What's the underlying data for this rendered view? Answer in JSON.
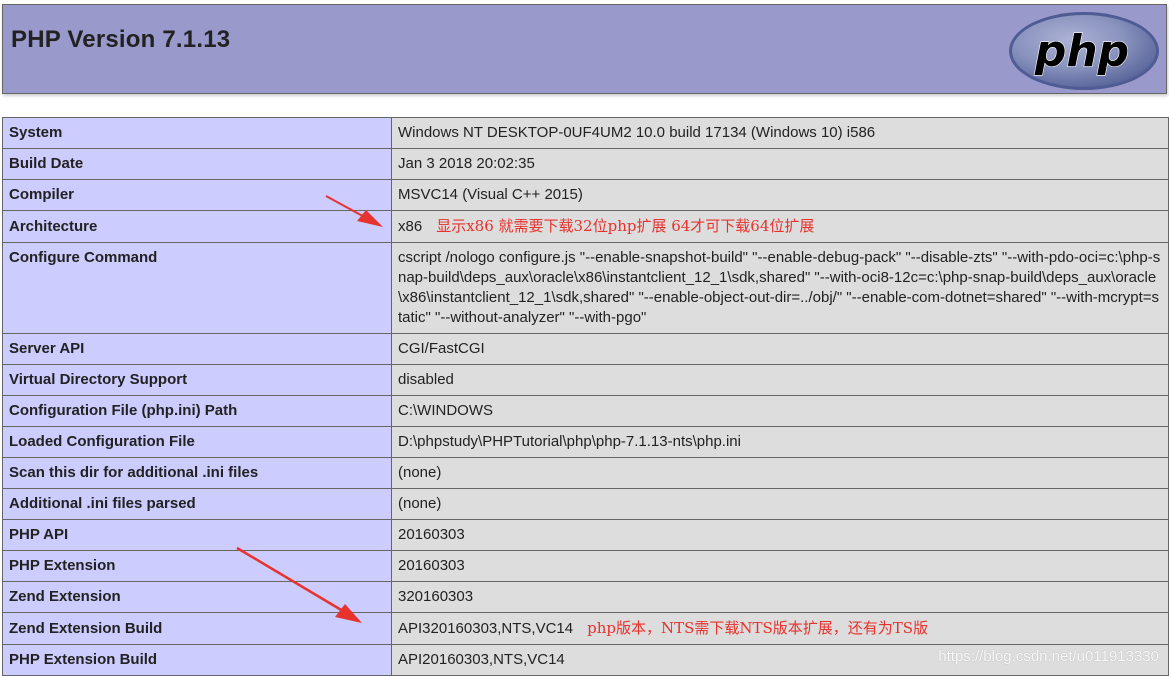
{
  "header": {
    "title": "PHP Version 7.1.13",
    "logo_text": "php",
    "logo_colors": {
      "oval": "#6c7eb7",
      "oval_border": "#4f5b93",
      "text": "#000000"
    },
    "background": "#9999cc"
  },
  "info_rows": [
    {
      "key": "System",
      "value": "Windows NT DESKTOP-0UF4UM2 10.0 build 17134 (Windows 10) i586"
    },
    {
      "key": "Build Date",
      "value": "Jan 3 2018 20:02:35"
    },
    {
      "key": "Compiler",
      "value": "MSVC14 (Visual C++ 2015)"
    },
    {
      "key": "Architecture",
      "value": "x86",
      "note": "显示x86 就需要下载32位php扩展 64才可下载64位扩展"
    },
    {
      "key": "Configure Command",
      "value": "cscript /nologo configure.js \"--enable-snapshot-build\" \"--enable-debug-pack\" \"--disable-zts\" \"--with-pdo-oci=c:\\php-snap-build\\deps_aux\\oracle\\x86\\instantclient_12_1\\sdk,shared\" \"--with-oci8-12c=c:\\php-snap-build\\deps_aux\\oracle\\x86\\instantclient_12_1\\sdk,shared\" \"--enable-object-out-dir=../obj/\" \"--enable-com-dotnet=shared\" \"--with-mcrypt=static\" \"--without-analyzer\" \"--with-pgo\""
    },
    {
      "key": "Server API",
      "value": "CGI/FastCGI"
    },
    {
      "key": "Virtual Directory Support",
      "value": "disabled"
    },
    {
      "key": "Configuration File (php.ini) Path",
      "value": "C:\\WINDOWS"
    },
    {
      "key": "Loaded Configuration File",
      "value": "D:\\phpstudy\\PHPTutorial\\php\\php-7.1.13-nts\\php.ini"
    },
    {
      "key": "Scan this dir for additional .ini files",
      "value": "(none)"
    },
    {
      "key": "Additional .ini files parsed",
      "value": "(none)"
    },
    {
      "key": "PHP API",
      "value": "20160303"
    },
    {
      "key": "PHP Extension",
      "value": "20160303"
    },
    {
      "key": "Zend Extension",
      "value": "320160303"
    },
    {
      "key": "Zend Extension Build",
      "value": "API320160303,NTS,VC14",
      "note": "php版本，NTS需下载NTS版本扩展，还有为TS版"
    },
    {
      "key": "PHP Extension Build",
      "value": "API20160303,NTS,VC14"
    }
  ],
  "annotation_color": "#e8322d",
  "watermark": "https://blog.csdn.net/u011913330"
}
